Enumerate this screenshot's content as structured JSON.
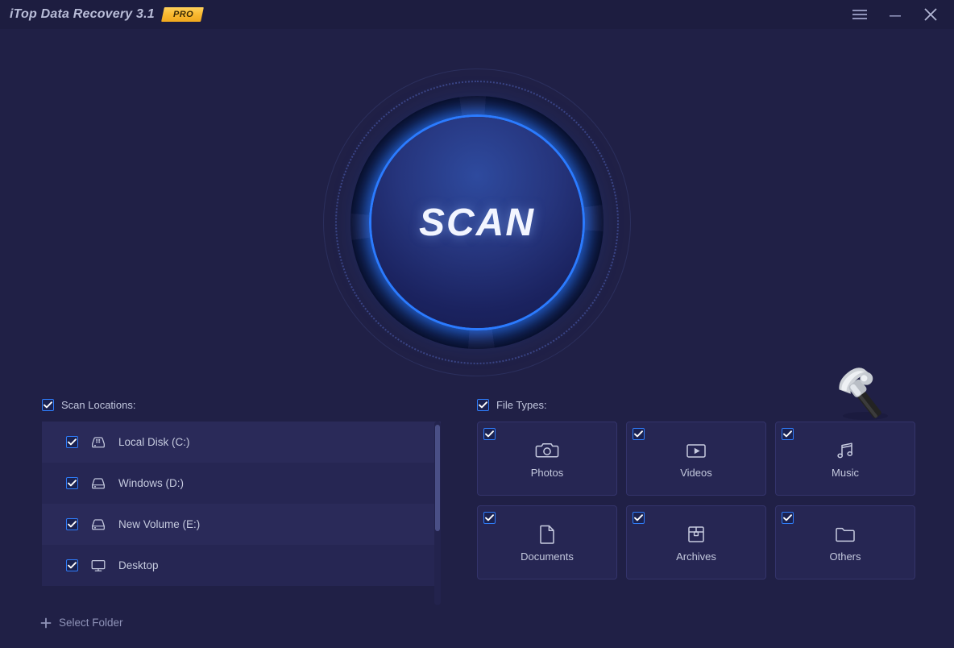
{
  "window": {
    "title": "iTop Data Recovery 3.1",
    "badge": "PRO",
    "controls": {
      "menu": "menu-icon",
      "minimize": "minimize-icon",
      "close": "close-icon"
    }
  },
  "scan": {
    "button_label": "SCAN",
    "tool_icon": "hammer-icon",
    "accent_color": "#2b7bff",
    "background_color": "#202046"
  },
  "scan_locations": {
    "header_label": "Scan Locations:",
    "header_checked": true,
    "items": [
      {
        "label": "Local Disk (C:)",
        "icon": "hard-disk-icon",
        "checked": true
      },
      {
        "label": "Windows (D:)",
        "icon": "drive-icon",
        "checked": true
      },
      {
        "label": "New Volume (E:)",
        "icon": "drive-icon",
        "checked": true
      },
      {
        "label": "Desktop",
        "icon": "monitor-icon",
        "checked": true
      }
    ],
    "select_folder_label": "Select Folder",
    "select_folder_icon": "plus-icon"
  },
  "file_types": {
    "header_label": "File Types:",
    "header_checked": true,
    "items": [
      {
        "label": "Photos",
        "icon": "camera-icon",
        "checked": true
      },
      {
        "label": "Videos",
        "icon": "video-play-icon",
        "checked": true
      },
      {
        "label": "Music",
        "icon": "music-note-icon",
        "checked": true
      },
      {
        "label": "Documents",
        "icon": "document-icon",
        "checked": true
      },
      {
        "label": "Archives",
        "icon": "archive-box-icon",
        "checked": true
      },
      {
        "label": "Others",
        "icon": "folder-icon",
        "checked": true
      }
    ]
  }
}
